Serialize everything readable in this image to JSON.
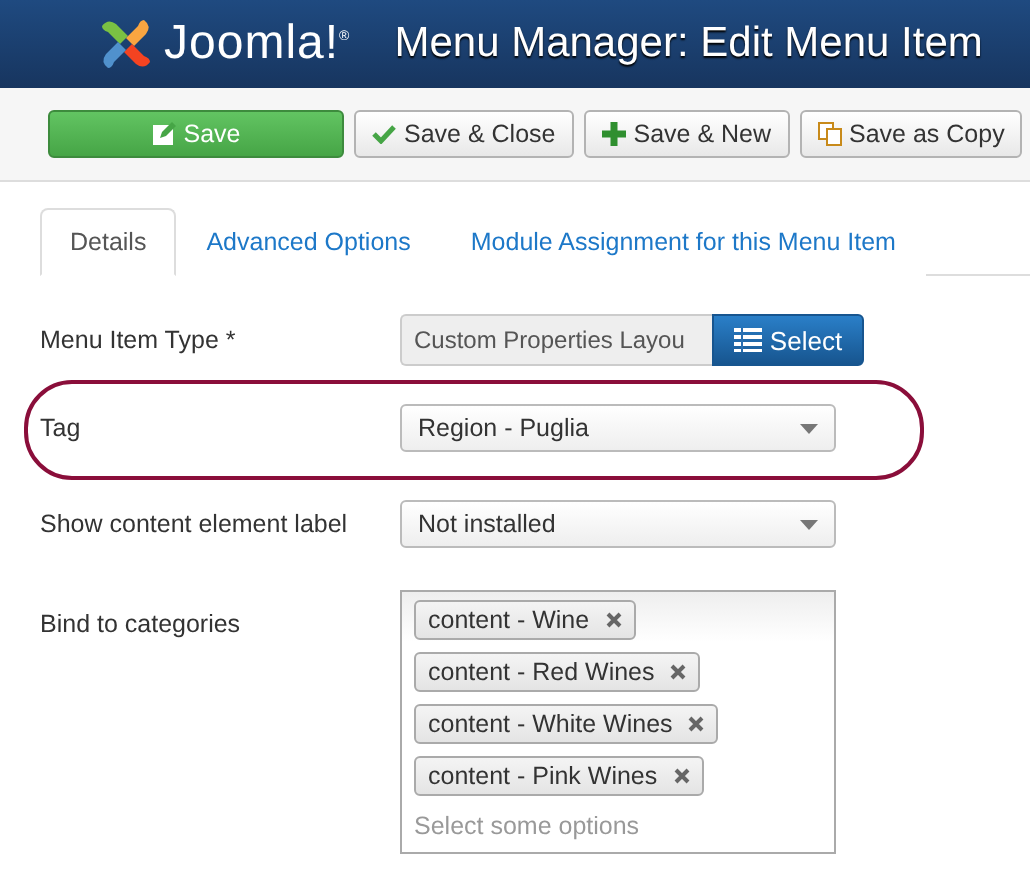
{
  "header": {
    "logo_text": "Joomla!$^{®}$",
    "title": "Menu Manager: Edit Menu Item"
  },
  "toolbar": [
    {
      "kind": "primary",
      "label": "Save"
    },
    {
      "kind": "default",
      "label": "Save & Close"
    },
    {
      "kind": "default",
      "label": "Save & New"
    },
    {
      "kind": "default",
      "label": "Save as Copy"
    }
  ],
  "tabs": [
    {
      "label": "Details",
      "selected": true
    },
    {
      "label": "Advanced Options",
      "selected": false
    },
    {
      "label": "Module Assignment for this Menu Item",
      "selected": false
    }
  ],
  "fields": [
    {
      "kind": "type",
      "label": "Menu Item Type *",
      "value": "Custom Properties Layou",
      "button": "Select",
      "highlighted": false
    },
    {
      "kind": "select",
      "label": "Tag",
      "value": "Region - Puglia",
      "highlighted": true
    },
    {
      "kind": "select",
      "label": "Show content element label",
      "value": "Not installed",
      "highlighted": false
    },
    {
      "kind": "multi",
      "label": "Bind to categories",
      "chips": [
        "content - Wine",
        "content - Red Wines",
        "content - White Wines",
        "content - Pink Wines"
      ],
      "placeholder": "Select some options",
      "highlighted": false
    }
  ]
}
